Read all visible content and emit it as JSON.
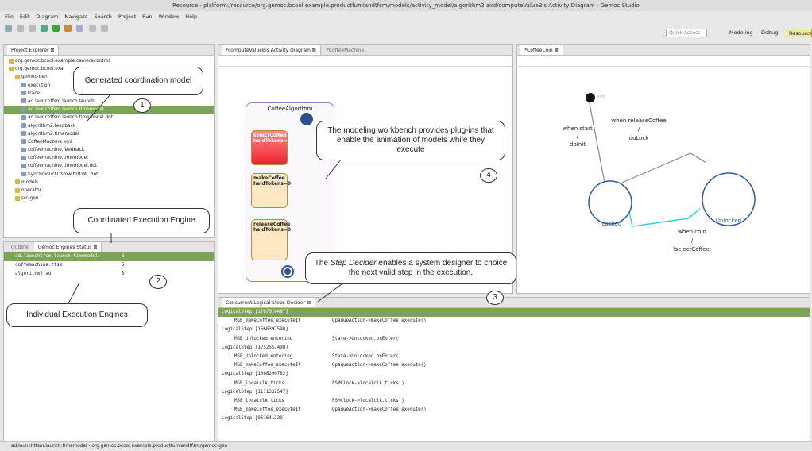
{
  "window": {
    "title": "Resource - platform:/resource/org.gemoc.bcool.example.productfumlandtfsm/models/activity_model/algorithm2.aird/computeValueBis Activity Diagram - Gemoc Studio"
  },
  "menu": [
    "File",
    "Edit",
    "Diagram",
    "Navigate",
    "Search",
    "Project",
    "Run",
    "Window",
    "Help"
  ],
  "toolbar": {
    "quick_access": "Quick Access",
    "perspectives": [
      "Modeling",
      "Debug",
      "Resource"
    ]
  },
  "explorer": {
    "tab": "Project Explorer ⊠",
    "rows": [
      {
        "label": "org.gemoc.bcool.example.cameracontrol",
        "indent": 0
      },
      {
        "label": "org.gemoc.bcool.exa",
        "indent": 0
      },
      {
        "label": "gemoc-gen",
        "indent": 1
      },
      {
        "label": "execution",
        "indent": 2
      },
      {
        "label": "trace",
        "indent": 2
      },
      {
        "label": "ad.launchtfsm.launch.launch",
        "indent": 2
      },
      {
        "label": "ad.launchtfsm.launch.timemodel",
        "indent": 2
      },
      {
        "label": "ad.launchtfsm.launch.timemodel.dot",
        "indent": 2
      },
      {
        "label": "algorithm2.feedback",
        "indent": 2
      },
      {
        "label": "algorithm2.timemodel",
        "indent": 2
      },
      {
        "label": "CoffeeMachine.xml",
        "indent": 2
      },
      {
        "label": "coffeemachine.feedback",
        "indent": 2
      },
      {
        "label": "coffeemachine.timemodel",
        "indent": 2
      },
      {
        "label": "coffeemachine.timemodel.dot",
        "indent": 2
      },
      {
        "label": "SyncProductTfsmwithfUML.dot",
        "indent": 2
      },
      {
        "label": "models",
        "indent": 1
      },
      {
        "label": "operator",
        "indent": 1
      },
      {
        "label": "src-gen",
        "indent": 1
      }
    ]
  },
  "engines": {
    "tabs": [
      "Outline",
      "Gemoc Engines Status ⊠"
    ],
    "rows": [
      {
        "name": "ad.launchtfsm.launch.timemodel",
        "count": "6"
      },
      {
        "name": "coffemachine.tfsm",
        "count": "5"
      },
      {
        "name": "algorithm2.ad",
        "count": "3"
      }
    ]
  },
  "activity": {
    "tabs": [
      "*computeValueBis Activity Diagram ⊠",
      "*CoffeeMachine"
    ],
    "container": "CoffeeAlgorithm",
    "states": [
      {
        "line1": "selectCoffee",
        "line2": "heldTokens=0"
      },
      {
        "line1": "makeCoffee",
        "line2": "heldTokens=0"
      },
      {
        "line1": "releaseCoffee",
        "line2": "heldTokens=0"
      }
    ]
  },
  "fsm": {
    "tab": "*CoffeeCoin ⊠",
    "init": "Init",
    "locked": "Locked",
    "unlocked": "Unlocked",
    "t1": [
      "when start",
      "/",
      "doInit"
    ],
    "t2": [
      "when releaseCoffee",
      "/",
      "doLock"
    ],
    "t3": [
      "when coin",
      "/",
      "!selectCoffee;"
    ]
  },
  "decider": {
    "tab": "Concurrent Logical Steps Decider ⊠",
    "rows": [
      {
        "kind": "step",
        "text": "LogicalStep [1767016487]",
        "sel": true
      },
      {
        "kind": "mse",
        "text": "MSE_makeCoffee_executeIt",
        "detail": "OpaqueAction->makeCoffee.execute()"
      },
      {
        "kind": "step",
        "text": "LogicalStep [1666397590]"
      },
      {
        "kind": "mse",
        "text": "MSE_Unlocked_entering",
        "detail": "State->Unlocked.onEnter()"
      },
      {
        "kind": "step",
        "text": "LogicalStep [1752557498]"
      },
      {
        "kind": "mse",
        "text": "MSE_Unlocked_entering",
        "detail": "State->Unlocked.onEnter()"
      },
      {
        "kind": "mse",
        "text": "MSE_makeCoffee_executeIt",
        "detail": "OpaqueAction->makeCoffee.execute()"
      },
      {
        "kind": "step",
        "text": "LogicalStep [1068290782]"
      },
      {
        "kind": "mse",
        "text": "MSE_localclk_ticks",
        "detail": "FSMClock->localclk.ticks()"
      },
      {
        "kind": "step",
        "text": "LogicalStep [1111332547]"
      },
      {
        "kind": "mse",
        "text": "MSE_localclk_ticks",
        "detail": "FSMClock->localclk.ticks()"
      },
      {
        "kind": "mse",
        "text": "MSE_makeCoffee_executeIt",
        "detail": "OpaqueAction->makeCoffee.execute()"
      },
      {
        "kind": "step",
        "text": "LogicalStep [951641239]"
      }
    ]
  },
  "callouts": {
    "c1": "Generated coordination model",
    "c2": "Coordinated Execution Engine",
    "c3": "Individual Execution Engines",
    "c4": "The modeling workbench provides plug-ins that enable the animation of models while they execute",
    "c5_pre": "The ",
    "c5_em": "Step Decider",
    "c5_post": " enables a system designer to choice the next valid step in the execution.",
    "n1": "1",
    "n2": "2",
    "n3": "3",
    "n4": "4"
  },
  "statusbar": "ad.launchtfsm.launch.timemodel - org.gemoc.bcool.example.productfumlandtfsm/gemoc-gen"
}
